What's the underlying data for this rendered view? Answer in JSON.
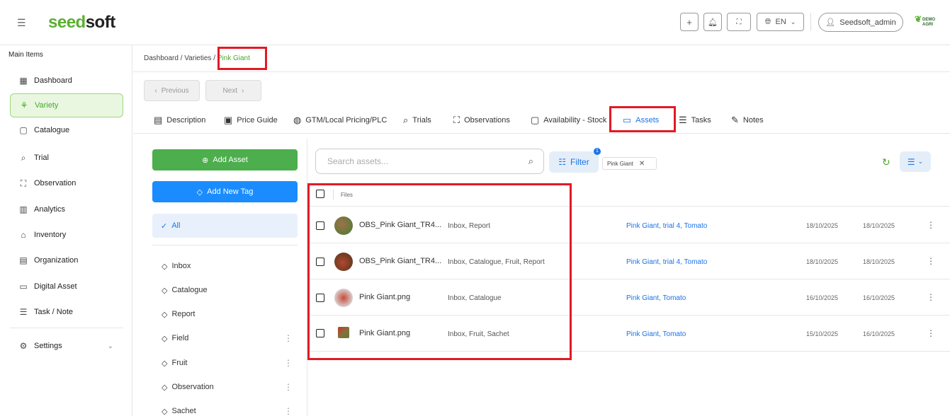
{
  "header": {
    "logo_main": "seed",
    "logo_tail": "soft",
    "language": "EN",
    "user": "Seedsoft_admin",
    "badge_line1": "DEMO",
    "badge_line2": "AGRI"
  },
  "sidebar": {
    "title": "Main Items",
    "items": [
      {
        "label": "Dashboard",
        "icon": "dashboard-icon"
      },
      {
        "label": "Variety",
        "icon": "sprout-icon"
      },
      {
        "label": "Catalogue",
        "icon": "catalogue-icon"
      },
      {
        "label": "Trial",
        "icon": "trial-icon"
      },
      {
        "label": "Observation",
        "icon": "observation-icon"
      },
      {
        "label": "Analytics",
        "icon": "analytics-icon"
      },
      {
        "label": "Inventory",
        "icon": "inventory-icon"
      },
      {
        "label": "Organization",
        "icon": "organization-icon"
      },
      {
        "label": "Digital Asset",
        "icon": "folder-icon"
      },
      {
        "label": "Task / Note",
        "icon": "task-icon"
      },
      {
        "label": "Settings",
        "icon": "gear-icon"
      }
    ]
  },
  "breadcrumb": {
    "path": "Dashboard / Varieties / ",
    "current": "Pink Giant"
  },
  "nav": {
    "previous": "Previous",
    "next": "Next"
  },
  "tabs": [
    {
      "label": "Description"
    },
    {
      "label": "Price Guide"
    },
    {
      "label": "GTM/Local Pricing/PLC"
    },
    {
      "label": "Trials"
    },
    {
      "label": "Observations"
    },
    {
      "label": "Availability - Stock"
    },
    {
      "label": "Assets"
    },
    {
      "label": "Tasks"
    },
    {
      "label": "Notes"
    }
  ],
  "tags": {
    "add_asset": "Add Asset",
    "add_tag": "Add New Tag",
    "all": "All",
    "items": [
      "Inbox",
      "Catalogue",
      "Report",
      "Field",
      "Fruit",
      "Observation",
      "Sachet"
    ]
  },
  "toolbar": {
    "search_placeholder": "Search assets...",
    "filter_label": "Filter",
    "filter_count": "1",
    "chip_label": "Pink Giant"
  },
  "table": {
    "header_files": "Files",
    "rows": [
      {
        "name": "OBS_Pink Giant_TR4...",
        "tags": "Inbox, Report",
        "links": "Pink Giant, trial 4, Tomato",
        "date1": "18/10/2025",
        "date2": "18/10/2025"
      },
      {
        "name": "OBS_Pink Giant_TR4...",
        "tags": "Inbox, Catalogue, Fruit, Report",
        "links": "Pink Giant, trial 4, Tomato",
        "date1": "18/10/2025",
        "date2": "18/10/2025"
      },
      {
        "name": "Pink Giant.png",
        "tags": "Inbox, Catalogue",
        "links": "Pink Giant, Tomato",
        "date1": "16/10/2025",
        "date2": "16/10/2025"
      },
      {
        "name": "Pink Giant.png",
        "tags": "Inbox, Fruit, Sachet",
        "links": "Pink Giant, Tomato",
        "date1": "15/10/2025",
        "date2": "16/10/2025"
      }
    ]
  },
  "colors": {
    "brand_green": "#5bb030",
    "accent_blue": "#1a73e8",
    "highlight_red": "#e01b24"
  }
}
